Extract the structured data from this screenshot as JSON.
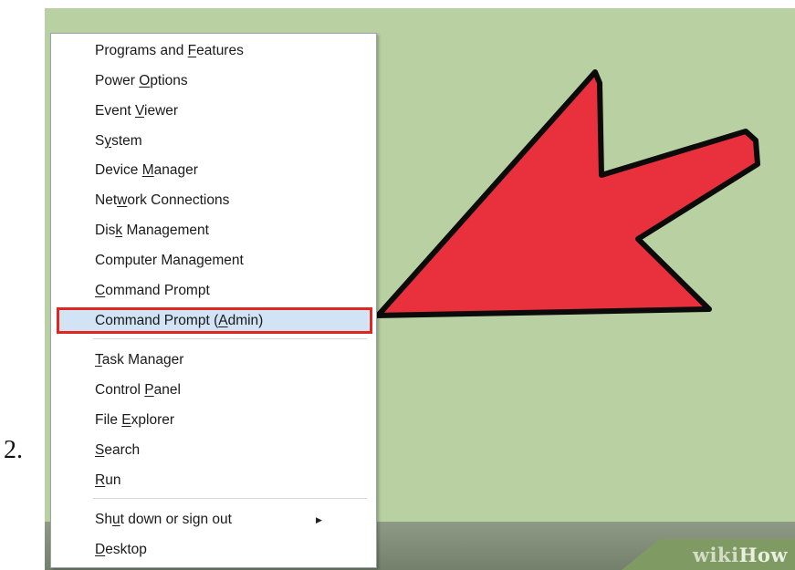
{
  "step_label": "2.",
  "menu": {
    "items": [
      {
        "before": "Programs and ",
        "key": "F",
        "after": "eatures"
      },
      {
        "before": "Power ",
        "key": "O",
        "after": "ptions"
      },
      {
        "before": "Event ",
        "key": "V",
        "after": "iewer"
      },
      {
        "before": "S",
        "key": "y",
        "after": "stem"
      },
      {
        "before": "Device ",
        "key": "M",
        "after": "anager"
      },
      {
        "before": "Net",
        "key": "w",
        "after": "ork Connections"
      },
      {
        "before": "Dis",
        "key": "k",
        "after": " Management"
      },
      {
        "before": "Computer Mana",
        "key": "g",
        "after": "ement"
      },
      {
        "before": "",
        "key": "C",
        "after": "ommand Prompt"
      },
      {
        "before": "Command Prompt (",
        "key": "A",
        "after": "dmin)"
      },
      {
        "before": "",
        "key": "T",
        "after": "ask Manager"
      },
      {
        "before": "Control ",
        "key": "P",
        "after": "anel"
      },
      {
        "before": "File ",
        "key": "E",
        "after": "xplorer"
      },
      {
        "before": "",
        "key": "S",
        "after": "earch"
      },
      {
        "before": "",
        "key": "R",
        "after": "un"
      },
      {
        "before": "Sh",
        "key": "u",
        "after": "t down or sign out"
      },
      {
        "before": "",
        "key": "D",
        "after": "esktop"
      }
    ],
    "selected_item": "Command Prompt (Admin)",
    "submenu_arrow": "▶"
  },
  "watermark": {
    "wiki": "wiki",
    "how": "How"
  },
  "colors": {
    "background": "#b9d0a2",
    "arrow_fill": "#e8313d",
    "highlight_border": "#e1251f",
    "selected_bg": "#d2e3f6"
  }
}
